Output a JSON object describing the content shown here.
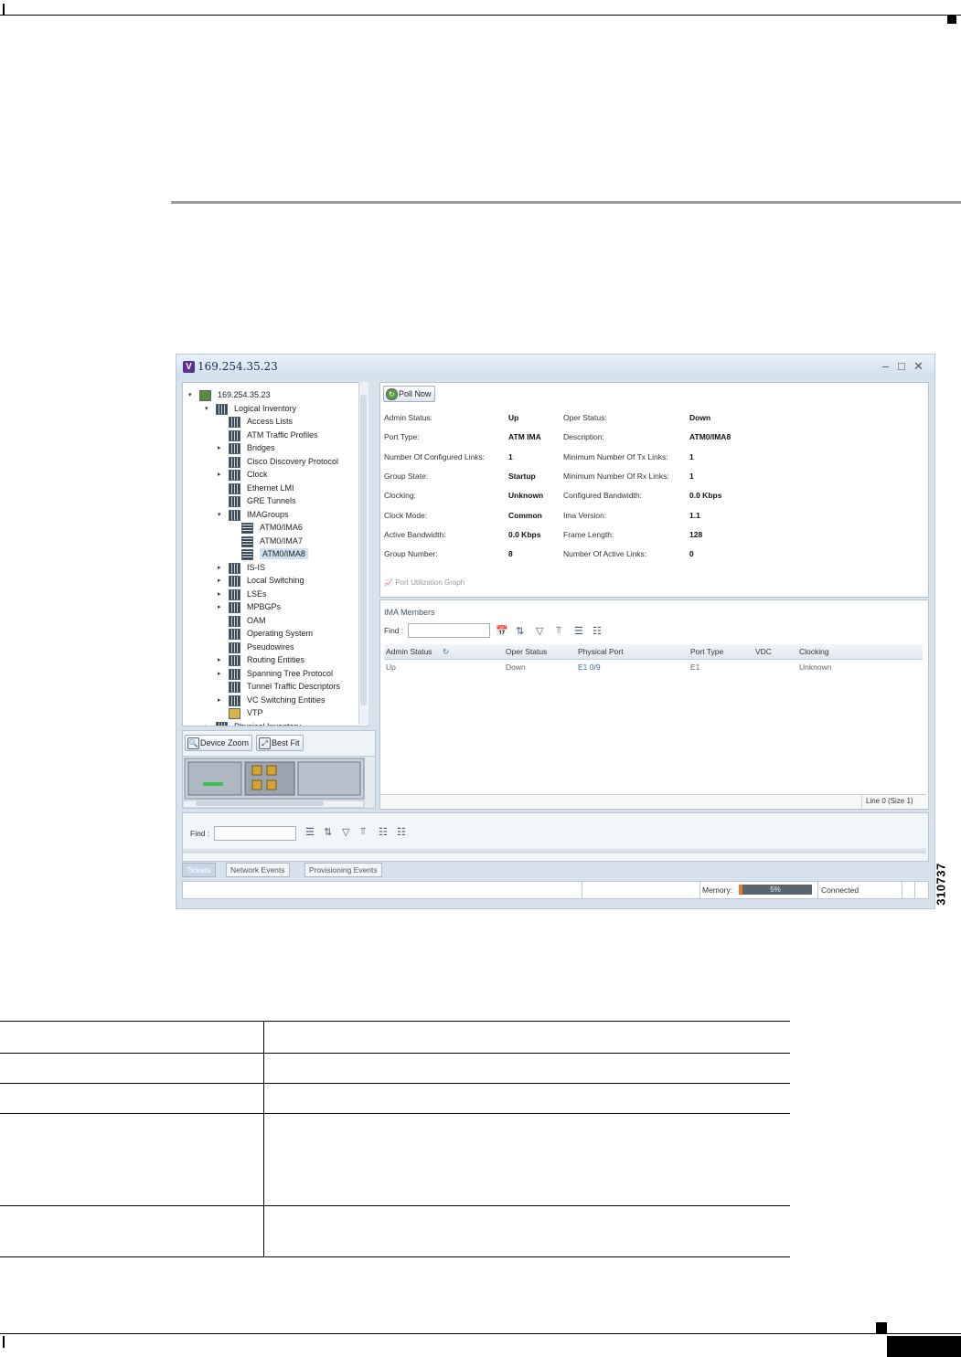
{
  "window": {
    "title": "169.254.35.23",
    "logo": "V",
    "controls": {
      "minimize": "–",
      "maximize": "□",
      "close": "✕"
    }
  },
  "tree": {
    "items": [
      {
        "label": "169.254.35.23"
      },
      {
        "label": "Logical Inventory"
      },
      {
        "label": "Access Lists"
      },
      {
        "label": "ATM Traffic Profiles"
      },
      {
        "label": "Bridges"
      },
      {
        "label": "Cisco Discovery Protocol"
      },
      {
        "label": "Clock"
      },
      {
        "label": "Ethernet LMI"
      },
      {
        "label": "GRE Tunnels"
      },
      {
        "label": "IMAGroups"
      },
      {
        "label": "ATM0/IMA6"
      },
      {
        "label": "ATM0/IMA7"
      },
      {
        "label": "ATM0/IMA8"
      },
      {
        "label": "IS-IS"
      },
      {
        "label": "Local Switching"
      },
      {
        "label": "LSEs"
      },
      {
        "label": "MPBGPs"
      },
      {
        "label": "OAM"
      },
      {
        "label": "Operating System"
      },
      {
        "label": "Pseudowires"
      },
      {
        "label": "Routing Entities"
      },
      {
        "label": "Spanning Tree Protocol"
      },
      {
        "label": "Tunnel Traffic Descriptors"
      },
      {
        "label": "VC Switching Entities"
      },
      {
        "label": "VTP"
      },
      {
        "label": "Physical Inventory"
      }
    ]
  },
  "zoom": {
    "device_zoom": "Device Zoom",
    "best_fit": "Best Fit"
  },
  "details": {
    "poll_now": "Poll Now",
    "fields": [
      {
        "label": "Admin Status:",
        "value": "Up"
      },
      {
        "label": "Oper Status:",
        "value": "Down"
      },
      {
        "label": "Port Type:",
        "value": "ATM IMA"
      },
      {
        "label": "Description:",
        "value": "ATM0/IMA8"
      },
      {
        "label": "Number Of Configured Links:",
        "value": "1"
      },
      {
        "label": "Minimum Number Of Tx Links:",
        "value": "1"
      },
      {
        "label": "Group State:",
        "value": "Startup"
      },
      {
        "label": "Minimum Number Of Rx Links:",
        "value": "1"
      },
      {
        "label": "Clocking:",
        "value": "Unknown"
      },
      {
        "label": "Configured Bandwidth:",
        "value": "0.0 Kbps"
      },
      {
        "label": "Clock Mode:",
        "value": "Common"
      },
      {
        "label": "Ima Version:",
        "value": "1.1"
      },
      {
        "label": "Active Bandwidth:",
        "value": "0.0 Kbps"
      },
      {
        "label": "Frame Length:",
        "value": "128"
      },
      {
        "label": "Group Number:",
        "value": "8"
      },
      {
        "label": "Number Of Active Links:",
        "value": "0"
      }
    ],
    "graph_link": "Port Utilization Graph"
  },
  "members": {
    "title": "IMA Members",
    "find_label": "Find :",
    "columns": [
      "Admin Status",
      "Oper Status",
      "Physical Port",
      "Port Type",
      "VDC",
      "Clocking"
    ],
    "rows": [
      [
        "Up",
        "Down",
        "E1 0/9",
        "E1",
        "",
        "Unknown"
      ]
    ],
    "footer": "Line 0 (Size 1)"
  },
  "bottom": {
    "find_label": "Find :",
    "tabs": [
      "Tickets",
      "Network Events",
      "Provisioning Events"
    ]
  },
  "status": {
    "memory_label": "Memory:",
    "memory_value": "5%",
    "memory_fraction": 0.05,
    "connection": "Connected"
  },
  "figure_id": "310737"
}
